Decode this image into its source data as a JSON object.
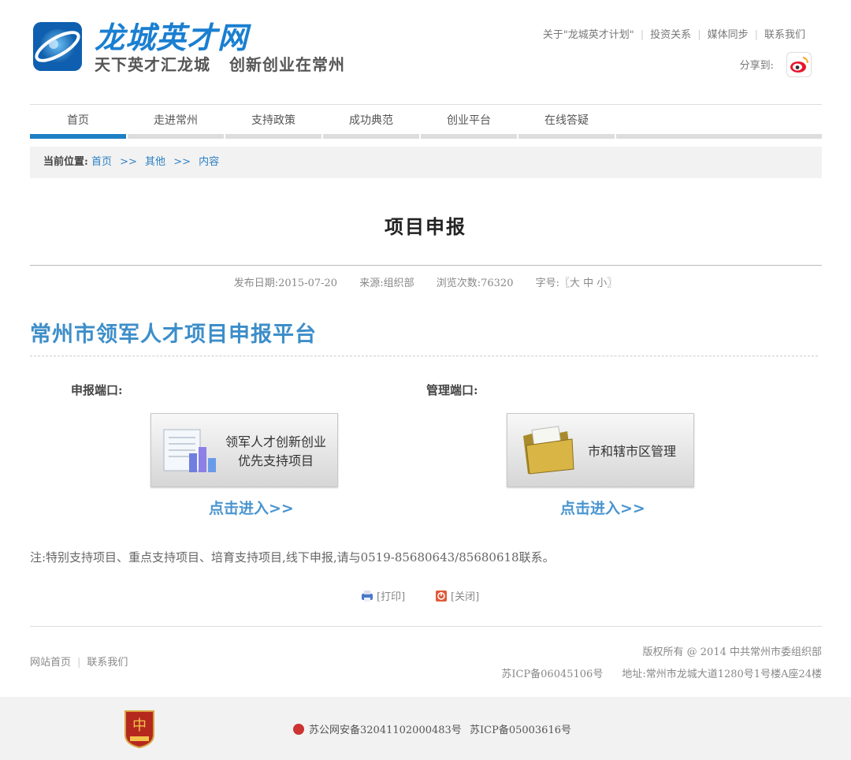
{
  "header": {
    "logo_title": "龙城英才网",
    "slogan_1": "天下英才汇龙城",
    "slogan_2": "创新创业在常州",
    "top_links": [
      "关于\"龙城英才计划\"",
      "投资关系",
      "媒体同步",
      "联系我们"
    ],
    "share_label": "分享到:",
    "share_icon": "weibo-icon"
  },
  "nav": {
    "items": [
      "首页",
      "走进常州",
      "支持政策",
      "成功典范",
      "创业平台",
      "在线答疑"
    ],
    "active_index": 0,
    "colors": {
      "active": "#1f7fc4",
      "inactive": "#dddddd"
    }
  },
  "breadcrumb": {
    "label": "当前位置:",
    "items": [
      "首页",
      "其他",
      "内容"
    ],
    "separator": ">>"
  },
  "article": {
    "title": "项目申报",
    "publish_date": "发布日期:2015-07-20",
    "source": "来源:组织部",
    "views": "浏览次数:76320",
    "font_size": "字号:〖大 中 小〗"
  },
  "platform": {
    "title": "常州市领军人才项目申报平台",
    "title_color": "#3d8ec9",
    "apply_port": {
      "label": "申报端口:",
      "button_line1": "领军人才创新创业",
      "button_line2": "优先支持项目",
      "icon": "chart-document-icon",
      "enter": "点击进入>>"
    },
    "manage_port": {
      "label": "管理端口:",
      "button_line1": "市和辖市区管理",
      "icon": "folder-icon",
      "enter": "点击进入>>"
    }
  },
  "note": "注:特别支持项目、重点支持项目、培育支持项目,线下申报,请与0519-85680643/85680618联系。",
  "actions": {
    "print": "[打印]",
    "close": "[关闭]"
  },
  "footer": {
    "links": [
      "网站首页",
      "联系我们"
    ],
    "copyright": "版权所有 @ 2014 中共常州市委组织部",
    "icp": "苏ICP备06045106号",
    "address": "地址:常州市龙城大道1280号1号楼A座24楼"
  },
  "bottom_bar": {
    "badge_icon": "government-badge-icon",
    "police": "苏公网安备32041102000483号",
    "icp": "苏ICP备05003616号"
  }
}
